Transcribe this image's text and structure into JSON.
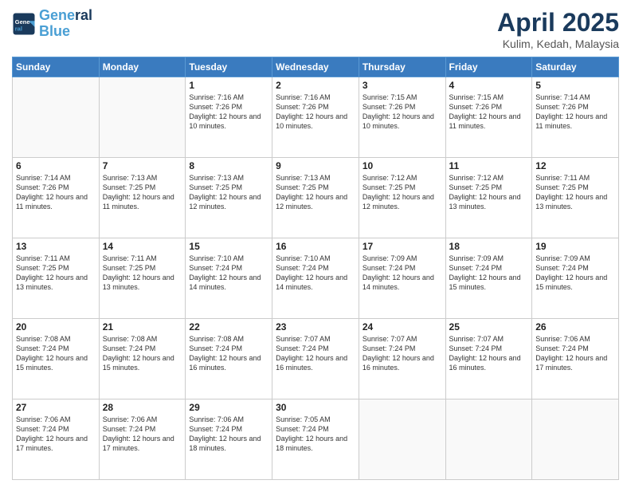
{
  "logo": {
    "line1": "General",
    "line2": "Blue"
  },
  "title": "April 2025",
  "subtitle": "Kulim, Kedah, Malaysia",
  "days_of_week": [
    "Sunday",
    "Monday",
    "Tuesday",
    "Wednesday",
    "Thursday",
    "Friday",
    "Saturday"
  ],
  "weeks": [
    [
      {
        "day": "",
        "info": ""
      },
      {
        "day": "",
        "info": ""
      },
      {
        "day": "1",
        "info": "Sunrise: 7:16 AM\nSunset: 7:26 PM\nDaylight: 12 hours and 10 minutes."
      },
      {
        "day": "2",
        "info": "Sunrise: 7:16 AM\nSunset: 7:26 PM\nDaylight: 12 hours and 10 minutes."
      },
      {
        "day": "3",
        "info": "Sunrise: 7:15 AM\nSunset: 7:26 PM\nDaylight: 12 hours and 10 minutes."
      },
      {
        "day": "4",
        "info": "Sunrise: 7:15 AM\nSunset: 7:26 PM\nDaylight: 12 hours and 11 minutes."
      },
      {
        "day": "5",
        "info": "Sunrise: 7:14 AM\nSunset: 7:26 PM\nDaylight: 12 hours and 11 minutes."
      }
    ],
    [
      {
        "day": "6",
        "info": "Sunrise: 7:14 AM\nSunset: 7:26 PM\nDaylight: 12 hours and 11 minutes."
      },
      {
        "day": "7",
        "info": "Sunrise: 7:13 AM\nSunset: 7:25 PM\nDaylight: 12 hours and 11 minutes."
      },
      {
        "day": "8",
        "info": "Sunrise: 7:13 AM\nSunset: 7:25 PM\nDaylight: 12 hours and 12 minutes."
      },
      {
        "day": "9",
        "info": "Sunrise: 7:13 AM\nSunset: 7:25 PM\nDaylight: 12 hours and 12 minutes."
      },
      {
        "day": "10",
        "info": "Sunrise: 7:12 AM\nSunset: 7:25 PM\nDaylight: 12 hours and 12 minutes."
      },
      {
        "day": "11",
        "info": "Sunrise: 7:12 AM\nSunset: 7:25 PM\nDaylight: 12 hours and 13 minutes."
      },
      {
        "day": "12",
        "info": "Sunrise: 7:11 AM\nSunset: 7:25 PM\nDaylight: 12 hours and 13 minutes."
      }
    ],
    [
      {
        "day": "13",
        "info": "Sunrise: 7:11 AM\nSunset: 7:25 PM\nDaylight: 12 hours and 13 minutes."
      },
      {
        "day": "14",
        "info": "Sunrise: 7:11 AM\nSunset: 7:25 PM\nDaylight: 12 hours and 13 minutes."
      },
      {
        "day": "15",
        "info": "Sunrise: 7:10 AM\nSunset: 7:24 PM\nDaylight: 12 hours and 14 minutes."
      },
      {
        "day": "16",
        "info": "Sunrise: 7:10 AM\nSunset: 7:24 PM\nDaylight: 12 hours and 14 minutes."
      },
      {
        "day": "17",
        "info": "Sunrise: 7:09 AM\nSunset: 7:24 PM\nDaylight: 12 hours and 14 minutes."
      },
      {
        "day": "18",
        "info": "Sunrise: 7:09 AM\nSunset: 7:24 PM\nDaylight: 12 hours and 15 minutes."
      },
      {
        "day": "19",
        "info": "Sunrise: 7:09 AM\nSunset: 7:24 PM\nDaylight: 12 hours and 15 minutes."
      }
    ],
    [
      {
        "day": "20",
        "info": "Sunrise: 7:08 AM\nSunset: 7:24 PM\nDaylight: 12 hours and 15 minutes."
      },
      {
        "day": "21",
        "info": "Sunrise: 7:08 AM\nSunset: 7:24 PM\nDaylight: 12 hours and 15 minutes."
      },
      {
        "day": "22",
        "info": "Sunrise: 7:08 AM\nSunset: 7:24 PM\nDaylight: 12 hours and 16 minutes."
      },
      {
        "day": "23",
        "info": "Sunrise: 7:07 AM\nSunset: 7:24 PM\nDaylight: 12 hours and 16 minutes."
      },
      {
        "day": "24",
        "info": "Sunrise: 7:07 AM\nSunset: 7:24 PM\nDaylight: 12 hours and 16 minutes."
      },
      {
        "day": "25",
        "info": "Sunrise: 7:07 AM\nSunset: 7:24 PM\nDaylight: 12 hours and 16 minutes."
      },
      {
        "day": "26",
        "info": "Sunrise: 7:06 AM\nSunset: 7:24 PM\nDaylight: 12 hours and 17 minutes."
      }
    ],
    [
      {
        "day": "27",
        "info": "Sunrise: 7:06 AM\nSunset: 7:24 PM\nDaylight: 12 hours and 17 minutes."
      },
      {
        "day": "28",
        "info": "Sunrise: 7:06 AM\nSunset: 7:24 PM\nDaylight: 12 hours and 17 minutes."
      },
      {
        "day": "29",
        "info": "Sunrise: 7:06 AM\nSunset: 7:24 PM\nDaylight: 12 hours and 18 minutes."
      },
      {
        "day": "30",
        "info": "Sunrise: 7:05 AM\nSunset: 7:24 PM\nDaylight: 12 hours and 18 minutes."
      },
      {
        "day": "",
        "info": ""
      },
      {
        "day": "",
        "info": ""
      },
      {
        "day": "",
        "info": ""
      }
    ]
  ]
}
